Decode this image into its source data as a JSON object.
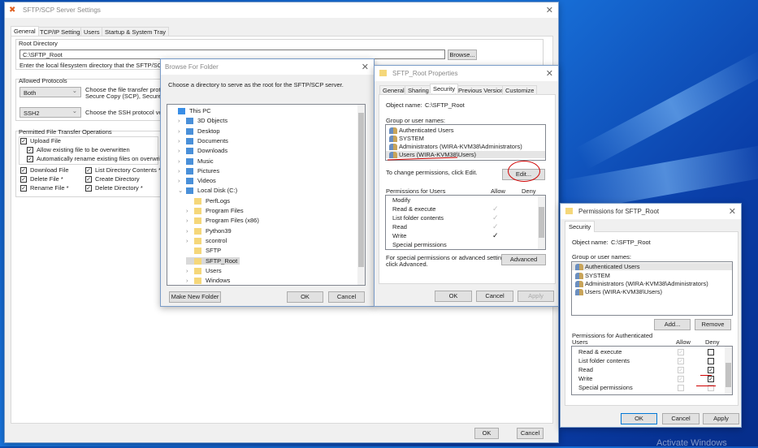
{
  "main": {
    "title": "SFTP/SCP Server Settings",
    "tabs": [
      "General",
      "TCP/IP Settings",
      "Users",
      "Startup & System Tray"
    ],
    "root_dir_label": "Root Directory",
    "root_dir_value": "C:\\SFTP_Root",
    "browse": "Browse...",
    "root_hint": "Enter the local filesystem directory that the SFTP/SCP serve",
    "protocols_label": "Allowed Protocols",
    "protocol_value": "Both",
    "protocol_hint1": "Choose the file transfer protocol",
    "protocol_hint2": "Secure Copy (SCP), Secure File",
    "ssh_value": "SSH2",
    "ssh_hint": "Choose the SSH protocol versio",
    "ops_label": "Permitted File Transfer Operations",
    "upload": "Upload File",
    "allow_overwrite": "Allow existing file to be overwritten",
    "auto_rename": "Automatically rename existing files on overwrite",
    "download": "Download File",
    "delete_file": "Delete File *",
    "rename_file": "Rename File *",
    "list_dir": "List Directory Contents *",
    "create_dir": "Create Directory",
    "delete_dir": "Delete Directory *",
    "ok": "OK",
    "cancel": "Cancel"
  },
  "browse": {
    "title": "Browse For Folder",
    "prompt": "Choose a directory to serve as the root for the SFTP/SCP server.",
    "tree": [
      {
        "label": "This PC",
        "lvl": 0,
        "exp": ""
      },
      {
        "label": "3D Objects",
        "lvl": 1,
        "exp": ">"
      },
      {
        "label": "Desktop",
        "lvl": 1,
        "exp": ">"
      },
      {
        "label": "Documents",
        "lvl": 1,
        "exp": ">"
      },
      {
        "label": "Downloads",
        "lvl": 1,
        "exp": ">"
      },
      {
        "label": "Music",
        "lvl": 1,
        "exp": ">"
      },
      {
        "label": "Pictures",
        "lvl": 1,
        "exp": ">"
      },
      {
        "label": "Videos",
        "lvl": 1,
        "exp": ">"
      },
      {
        "label": "Local Disk (C:)",
        "lvl": 1,
        "exp": "v"
      },
      {
        "label": "PerfLogs",
        "lvl": 2,
        "exp": ""
      },
      {
        "label": "Program Files",
        "lvl": 2,
        "exp": ">"
      },
      {
        "label": "Program Files (x86)",
        "lvl": 2,
        "exp": ">"
      },
      {
        "label": "Python39",
        "lvl": 2,
        "exp": ">"
      },
      {
        "label": "scontrol",
        "lvl": 2,
        "exp": ">"
      },
      {
        "label": "SFTP",
        "lvl": 2,
        "exp": ""
      },
      {
        "label": "SFTP_Root",
        "lvl": 2,
        "exp": "",
        "sel": true
      },
      {
        "label": "Users",
        "lvl": 2,
        "exp": ">"
      },
      {
        "label": "Windows",
        "lvl": 2,
        "exp": ">"
      }
    ],
    "new_folder": "Make New Folder",
    "ok": "OK",
    "cancel": "Cancel"
  },
  "props": {
    "title": "SFTP_Root Properties",
    "tabs": [
      "General",
      "Sharing",
      "Security",
      "Previous Versions",
      "Customize"
    ],
    "object_label": "Object name:",
    "object_value": "C:\\SFTP_Root",
    "group_label": "Group or user names:",
    "users": [
      "Authenticated Users",
      "SYSTEM",
      "Administrators (WIRA-KVM38\\Administrators)",
      "Users (WIRA-KVM38\\Users)"
    ],
    "change_hint": "To change permissions, click Edit.",
    "edit": "Edit...",
    "perm_label": "Permissions for Users",
    "allow": "Allow",
    "deny": "Deny",
    "perms": [
      "Modify",
      "Read & execute",
      "List folder contents",
      "Read",
      "Write",
      "Special permissions"
    ],
    "adv_hint1": "For special permissions or advanced settings,",
    "adv_hint2": "click Advanced.",
    "advanced": "Advanced",
    "ok": "OK",
    "cancel": "Cancel",
    "apply": "Apply"
  },
  "perm": {
    "title": "Permissions for SFTP_Root",
    "tab": "Security",
    "object_label": "Object name:",
    "object_value": "C:\\SFTP_Root",
    "group_label": "Group or user names:",
    "users": [
      "Authenticated Users",
      "SYSTEM",
      "Administrators (WIRA-KVM38\\Administrators)",
      "Users (WIRA-KVM38\\Users)"
    ],
    "add": "Add...",
    "remove": "Remove",
    "perm_label1": "Permissions for Authenticated",
    "perm_label2": "Users",
    "allow": "Allow",
    "deny": "Deny",
    "perms": [
      "Read & execute",
      "List folder contents",
      "Read",
      "Write",
      "Special permissions"
    ],
    "ok": "OK",
    "cancel": "Cancel",
    "apply": "Apply"
  },
  "watermark": "Activate Windows"
}
